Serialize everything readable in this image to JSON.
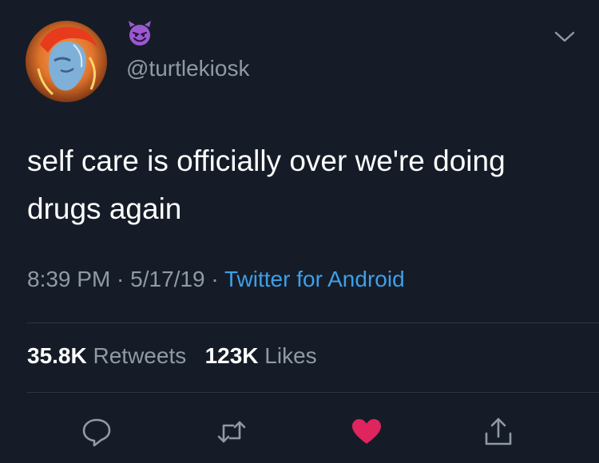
{
  "tweet": {
    "handle": "@turtlekiosk",
    "name_emoji": "smiling-devil-emoji",
    "text": "self care is officially over we're doing drugs again",
    "time": "8:39 PM",
    "separator1": " · ",
    "date": "5/17/19",
    "separator2": " · ",
    "source": "Twitter for Android"
  },
  "stats": {
    "retweets_count": "35.8K",
    "retweets_label": "Retweets",
    "likes_count": "123K",
    "likes_label": "Likes"
  },
  "icons": {
    "reply": "reply-icon",
    "retweet": "retweet-icon",
    "like": "heart-icon",
    "share": "share-icon",
    "menu": "chevron-down-icon"
  },
  "colors": {
    "background": "#151c27",
    "text": "#ffffff",
    "muted": "#8f9aa6",
    "link": "#3e9fe8",
    "like": "#e0245e",
    "icon": "#8f9aa6"
  }
}
